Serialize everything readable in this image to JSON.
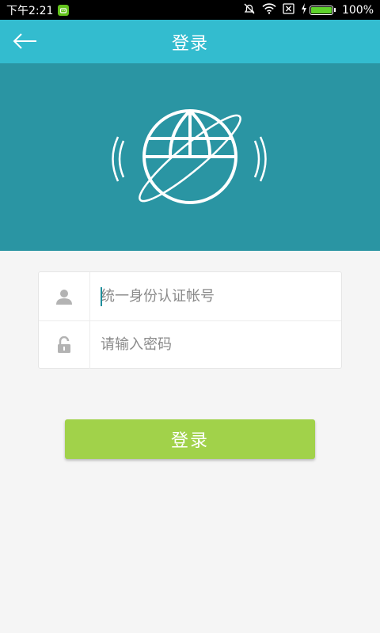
{
  "status_bar": {
    "time": "下午2:21",
    "battery": "100%",
    "battery_level": 1.0,
    "icons": [
      "android-notification-icon",
      "alarm-off-icon",
      "wifi-icon",
      "no-sim-icon",
      "charging-icon",
      "battery-icon"
    ]
  },
  "app_bar": {
    "title": "登录",
    "back_icon": "arrow-left-icon",
    "background": "#33bccf"
  },
  "banner": {
    "background": "#2a95a3",
    "logo_icon": "globe-with-signal-waves-icon"
  },
  "form": {
    "account": {
      "placeholder": "统一身份认证帐号",
      "value": "",
      "icon": "user-icon"
    },
    "password": {
      "placeholder": "请输入密码",
      "value": "",
      "icon": "unlock-icon"
    }
  },
  "login_button": {
    "label": "登录",
    "color": "#a1d24a"
  }
}
